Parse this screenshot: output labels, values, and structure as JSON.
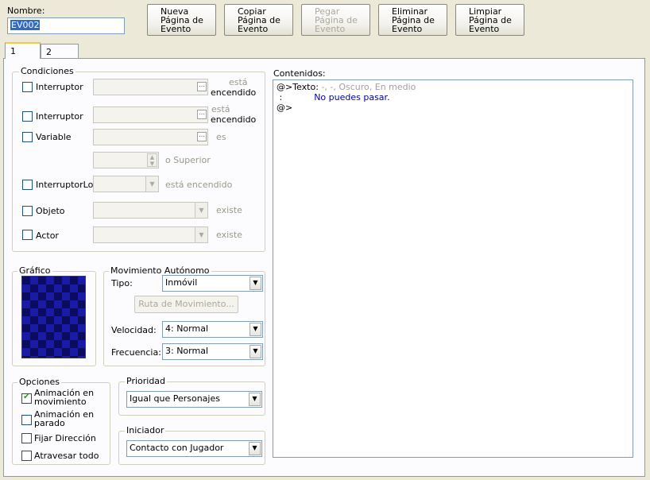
{
  "name": {
    "label": "Nombre:",
    "value": "EV002"
  },
  "toolbar": [
    {
      "label": "Nueva\nPágina de\nEvento",
      "enabled": true
    },
    {
      "label": "Copiar\nPágina de\nEvento",
      "enabled": true
    },
    {
      "label": "Pegar\nPágina de\nEvento",
      "enabled": false
    },
    {
      "label": "Eliminar\nPágina de\nEvento",
      "enabled": true
    },
    {
      "label": "Limpiar\nPágina de\nEvento",
      "enabled": true
    }
  ],
  "tabs": [
    "1",
    "2"
  ],
  "conditions": {
    "title": "Condiciones",
    "switch1": {
      "label": "Interruptor",
      "suffix_top": "está",
      "suffix_bottom": "encendido"
    },
    "switch2": {
      "label": "Interruptor",
      "suffix_top": "está",
      "suffix_bottom": "encendido"
    },
    "variable": {
      "label": "Variable",
      "suffix": "es",
      "compare": "o Superior"
    },
    "selfswitch": {
      "label": "InterruptorLo",
      "suffix": "está encendido"
    },
    "item": {
      "label": "Objeto",
      "suffix": "existe"
    },
    "actor": {
      "label": "Actor",
      "suffix": "existe"
    }
  },
  "graphic": {
    "title": "Gráfico"
  },
  "autonomous": {
    "title": "Movimiento Autónomo",
    "type_label": "Tipo:",
    "type_value": "Inmóvil",
    "route_button": "Ruta de Movimiento...",
    "speed_label": "Velocidad:",
    "speed_value": "4: Normal",
    "freq_label": "Frecuencia:",
    "freq_value": "3: Normal"
  },
  "options": {
    "title": "Opciones",
    "move_anim": "Animación en\nmovimiento",
    "stop_anim": "Animación en\nparado",
    "fix_dir": "Fijar Dirección",
    "through": "Atravesar todo"
  },
  "priority": {
    "title": "Prioridad",
    "value": "Igual que Personajes"
  },
  "trigger": {
    "title": "Iniciador",
    "value": "Contacto con Jugador"
  },
  "contents": {
    "label": "Contenidos:",
    "line1_cmd": "@>Texto:",
    "line1_args": " -, -, Oscuro, En medio",
    "line2_prefix": " :",
    "line2_text": "No puedes pasar.",
    "line3": "@>"
  }
}
